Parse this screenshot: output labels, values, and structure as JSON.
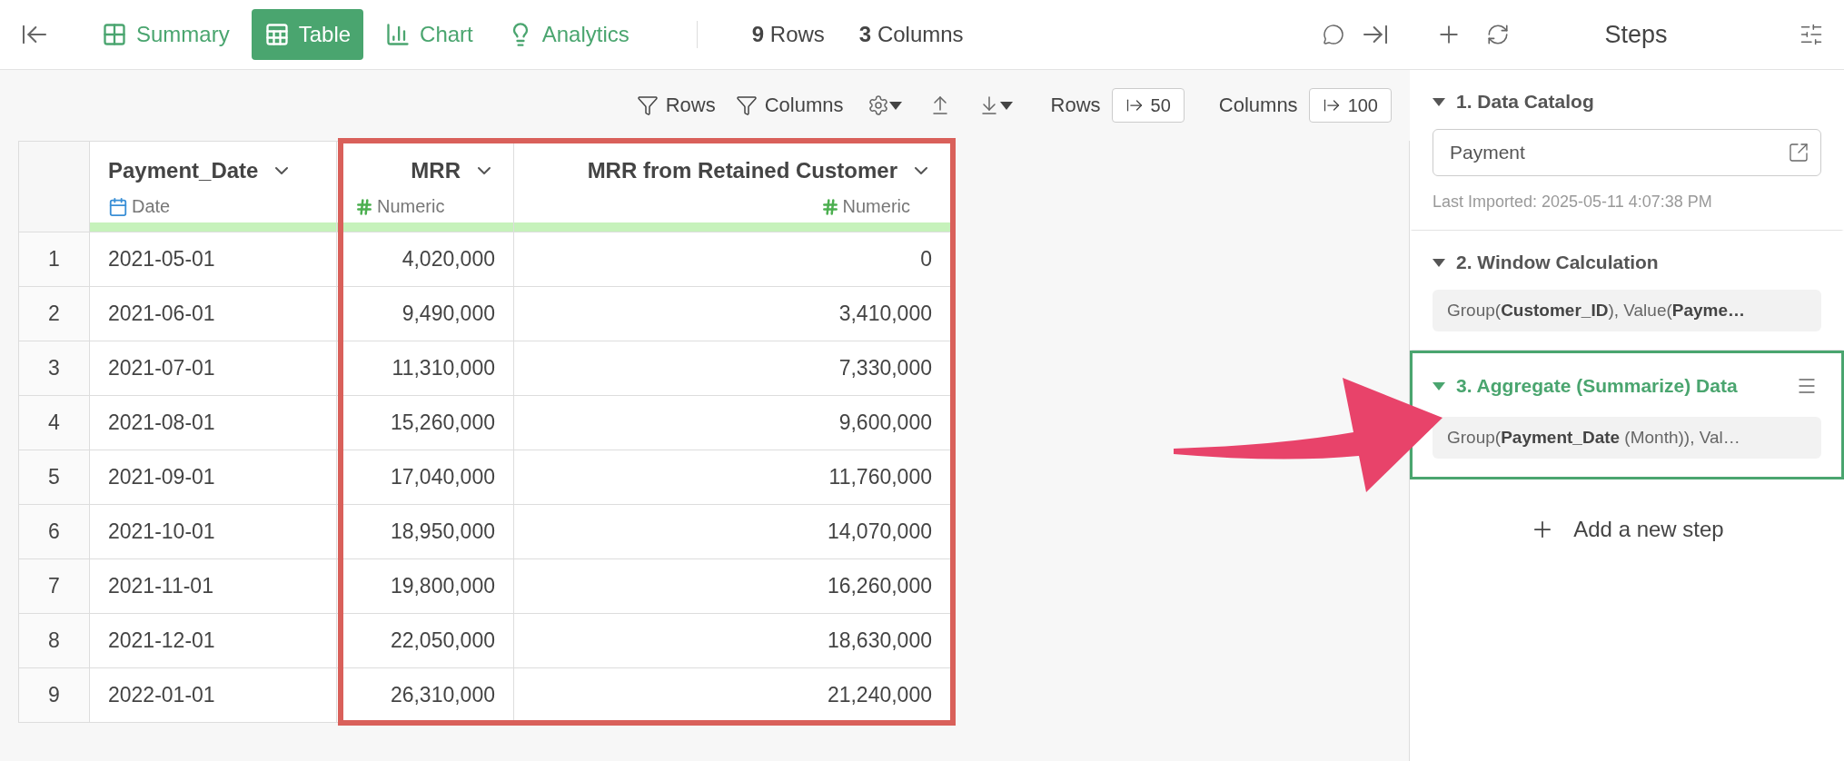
{
  "toolbar": {
    "views": [
      {
        "label": "Summary",
        "kind": "summary",
        "selected": false
      },
      {
        "label": "Table",
        "kind": "table",
        "selected": true
      },
      {
        "label": "Chart",
        "kind": "chart",
        "selected": false
      },
      {
        "label": "Analytics",
        "kind": "analytics",
        "selected": false
      }
    ],
    "row_count": {
      "number": "9",
      "label": "Rows"
    },
    "column_count": {
      "number": "3",
      "label": "Columns"
    }
  },
  "table_toolbar": {
    "filter_rows": "Rows",
    "filter_columns": "Columns",
    "rows_label": "Rows",
    "rows_value": "50",
    "columns_label": "Columns",
    "columns_value": "100"
  },
  "table": {
    "columns": [
      {
        "name": "Payment_Date",
        "type": "Date",
        "kind": "date"
      },
      {
        "name": "MRR",
        "type": "Numeric",
        "kind": "numeric"
      },
      {
        "name": "MRR from Retained Customer",
        "type": "Numeric",
        "kind": "numeric"
      }
    ],
    "rows": [
      {
        "index": "1",
        "cells": [
          "2021-05-01",
          "4,020,000",
          "0"
        ]
      },
      {
        "index": "2",
        "cells": [
          "2021-06-01",
          "9,490,000",
          "3,410,000"
        ]
      },
      {
        "index": "3",
        "cells": [
          "2021-07-01",
          "11,310,000",
          "7,330,000"
        ]
      },
      {
        "index": "4",
        "cells": [
          "2021-08-01",
          "15,260,000",
          "9,600,000"
        ]
      },
      {
        "index": "5",
        "cells": [
          "2021-09-01",
          "17,040,000",
          "11,760,000"
        ]
      },
      {
        "index": "6",
        "cells": [
          "2021-10-01",
          "18,950,000",
          "14,070,000"
        ]
      },
      {
        "index": "7",
        "cells": [
          "2021-11-01",
          "19,800,000",
          "16,260,000"
        ]
      },
      {
        "index": "8",
        "cells": [
          "2021-12-01",
          "22,050,000",
          "18,630,000"
        ]
      },
      {
        "index": "9",
        "cells": [
          "2022-01-01",
          "26,310,000",
          "21,240,000"
        ]
      }
    ]
  },
  "steps_panel": {
    "title": "Steps",
    "steps": [
      {
        "title": "1. Data Catalog",
        "kind": "source",
        "selected": false,
        "field": "Payment",
        "note": "Last Imported: 2025-05-11 4:07:38 PM"
      },
      {
        "title": "2. Window Calculation",
        "kind": "summary",
        "selected": false,
        "summary": "Group(**Customer_ID**), Value(**Payme…**"
      },
      {
        "title": "3. Aggregate (Summarize) Data",
        "kind": "summary",
        "selected": true,
        "summary": "Group(**Payment_Date** (Month)), Val…"
      }
    ],
    "add_step": "Add a new step"
  }
}
